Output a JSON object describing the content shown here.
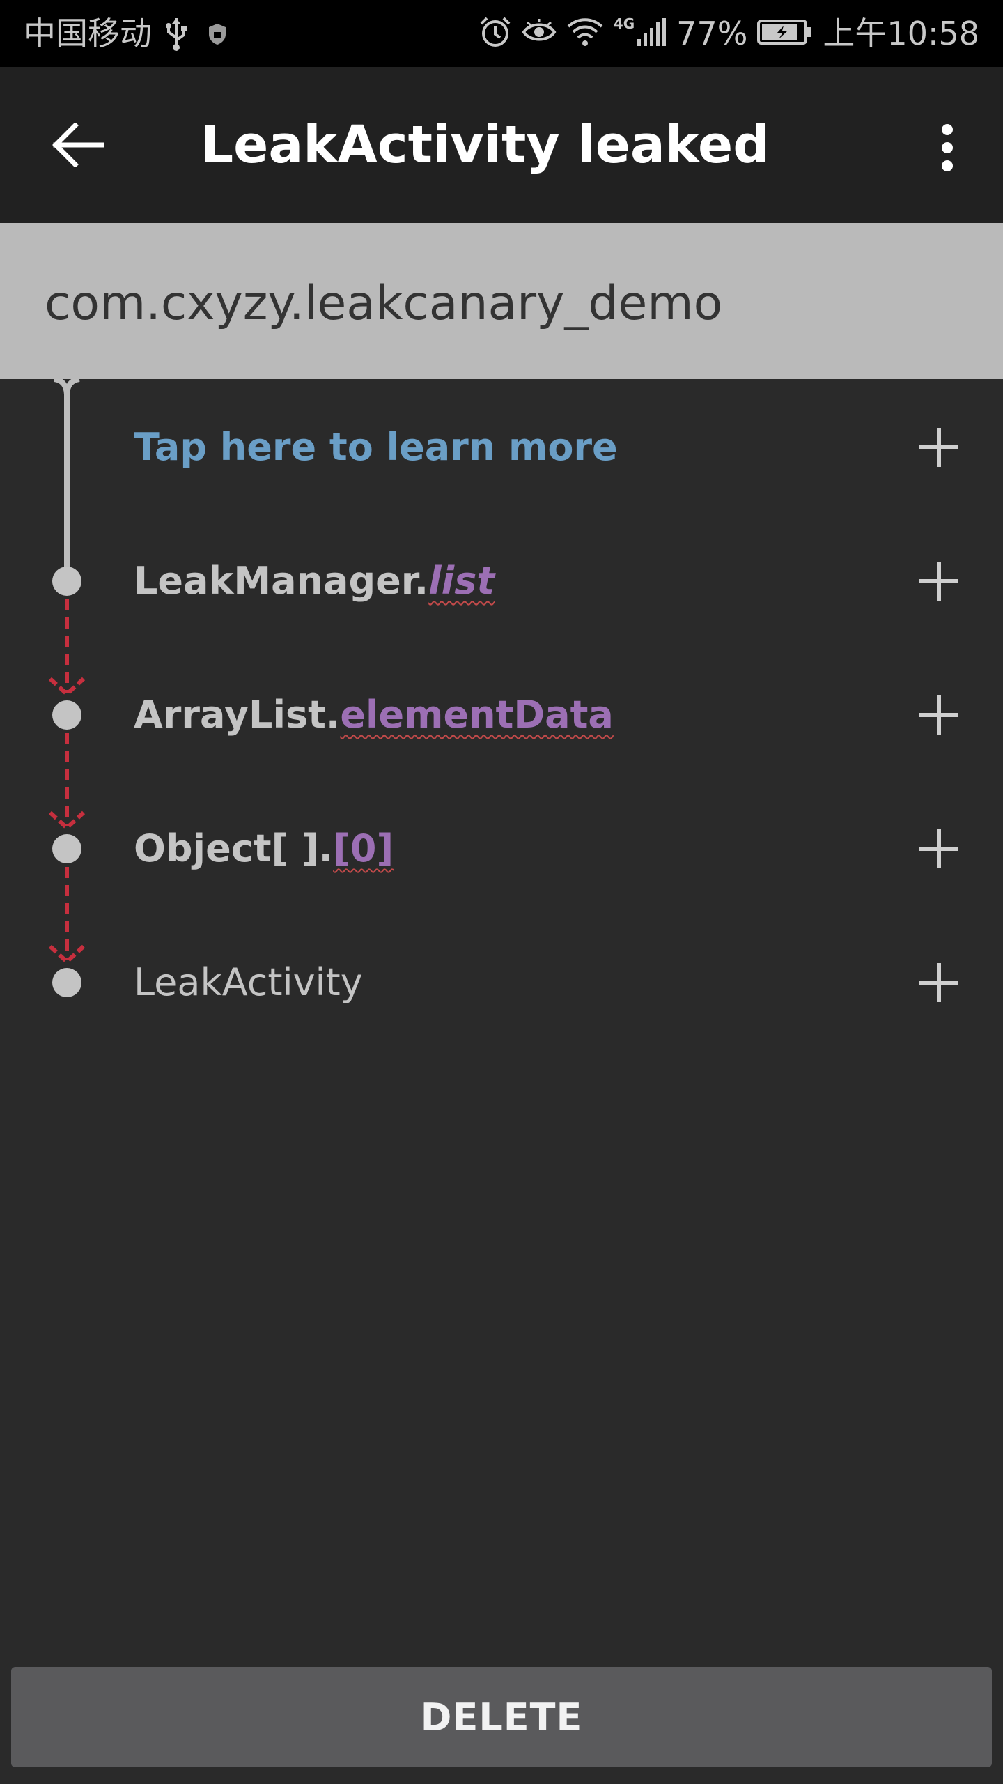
{
  "status_bar": {
    "carrier": "中国移动",
    "network": "4G",
    "battery_percent": "77%",
    "time": "上午10:58",
    "icons": [
      "usb-icon",
      "shield-icon",
      "alarm-icon",
      "eye-icon",
      "wifi-icon",
      "signal-icon",
      "battery-charging-icon"
    ]
  },
  "toolbar": {
    "title": "LeakActivity leaked",
    "back_icon": "arrow-left-icon",
    "menu_icon": "more-vert-icon"
  },
  "header": {
    "app_package": "com.cxyzy.leakcanary_demo"
  },
  "trace": {
    "learn_more": "Tap here to learn more",
    "rows": [
      {
        "class_name": "LeakManager.",
        "field": "list"
      },
      {
        "class_name": "ArrayList.",
        "field": "elementData"
      },
      {
        "class_name": "Object[ ].",
        "field": "[0]"
      },
      {
        "class_name": "LeakActivity",
        "field": ""
      }
    ],
    "expand_icon": "plus-icon"
  },
  "footer": {
    "delete_label": "DELETE"
  },
  "colors": {
    "background": "#2a2a2a",
    "toolbar": "#212121",
    "header": "#bababa",
    "link": "#6a9ec6",
    "field": "#9c6fb4",
    "leak_path": "#c62f3e",
    "button": "#5a5a5c"
  }
}
